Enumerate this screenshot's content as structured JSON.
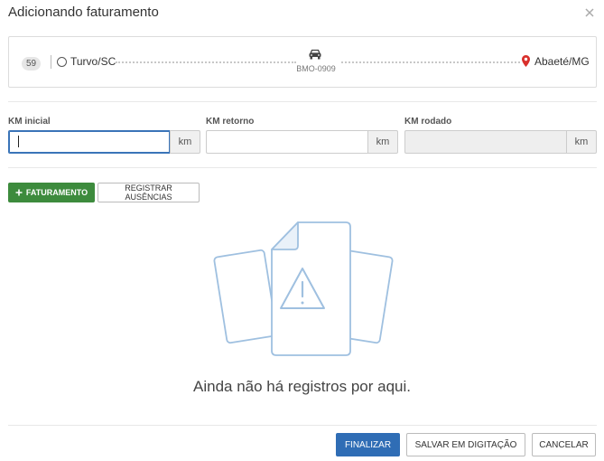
{
  "modal": {
    "title": "Adicionando faturamento",
    "close_icon": "close-icon"
  },
  "route": {
    "badge": "59",
    "origin": "Turvo/SC",
    "vehicle_icon": "car-icon",
    "vehicle_plate": "BMO-0909",
    "destination_icon": "map-pin-icon",
    "destination": "Abaeté/MG",
    "destination_pin_color": "#d9302c"
  },
  "fields": [
    {
      "label": "KM inicial",
      "value": "",
      "unit": "km",
      "state": "focused"
    },
    {
      "label": "KM retorno",
      "value": "",
      "unit": "km",
      "state": "normal"
    },
    {
      "label": "KM rodado",
      "value": "",
      "unit": "km",
      "state": "disabled"
    }
  ],
  "actions": {
    "faturamento_icon": "plus-icon",
    "faturamento_label": "FATURAMENTO",
    "ausencias_label": "REGISTRAR AUSÊNCIAS"
  },
  "empty_state": {
    "illustration": "empty-documents-warning-icon",
    "message": "Ainda não há registros por aqui."
  },
  "footer": {
    "finalizar_label": "FINALIZAR",
    "salvar_label": "SALVAR EM DIGITAÇÃO",
    "cancelar_label": "CANCELAR"
  },
  "colors": {
    "primary": "#2f6db5",
    "success": "#3d8b3d",
    "focus": "#3a74b8"
  }
}
